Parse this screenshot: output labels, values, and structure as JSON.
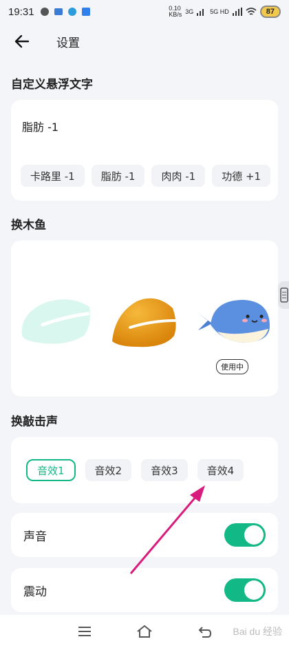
{
  "status_bar": {
    "time": "19:31",
    "network_speed": "0.10\nKB/s",
    "signal_1": "3G",
    "signal_2": "5G HD",
    "battery": "87"
  },
  "header": {
    "title": "设置"
  },
  "floating_text": {
    "section_title": "自定义悬浮文字",
    "current_value": "脂肪 -1",
    "options": [
      "卡路里 -1",
      "脂肪 -1",
      "肉肉 -1",
      "功德 +1"
    ]
  },
  "fish": {
    "section_title": "换木鱼",
    "in_use_label": "使用中",
    "options": [
      "mint-fish",
      "orange-fish",
      "whale"
    ],
    "selected_index": 2
  },
  "sound_effect": {
    "section_title": "换敲击声",
    "options": [
      "音效1",
      "音效2",
      "音效3",
      "音效4"
    ],
    "selected_index": 0
  },
  "toggles": {
    "sound_label": "声音",
    "sound_on": true,
    "vibrate_label": "震动",
    "vibrate_on": true
  },
  "watermark": "Bai du 经验",
  "colors": {
    "accent": "#12b886",
    "annotation_arrow": "#d81b7c"
  }
}
